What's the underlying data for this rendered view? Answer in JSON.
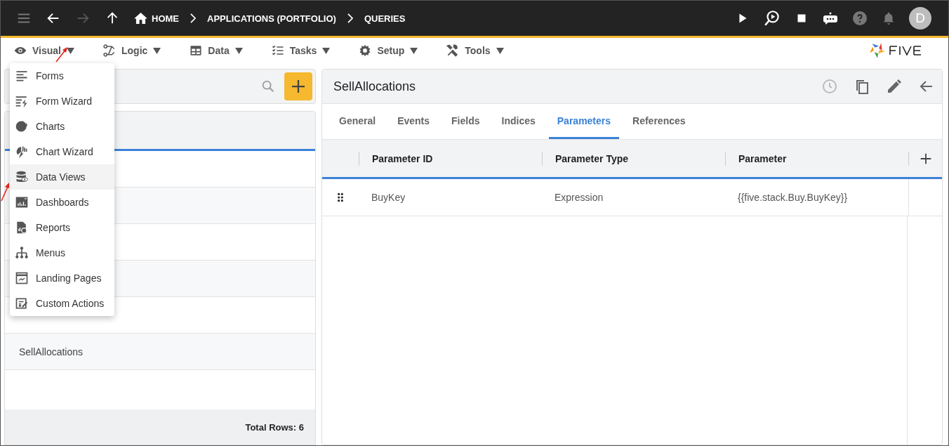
{
  "breadcrumbs": [
    {
      "label": "HOME",
      "kind": "home"
    },
    {
      "label": "APPLICATIONS (PORTFOLIO)",
      "kind": "crumb"
    },
    {
      "label": "QUERIES",
      "kind": "crumb"
    }
  ],
  "user": {
    "initial": "D"
  },
  "toolbar": [
    "Visual",
    "Logic",
    "Data",
    "Tasks",
    "Setup",
    "Tools"
  ],
  "menu": [
    {
      "label": "Forms",
      "highlighted": false
    },
    {
      "label": "Form Wizard",
      "highlighted": false
    },
    {
      "label": "Charts",
      "highlighted": false
    },
    {
      "label": "Chart Wizard",
      "highlighted": false
    },
    {
      "label": "Data Views",
      "highlighted": true
    },
    {
      "label": "Dashboards",
      "highlighted": false
    },
    {
      "label": "Reports",
      "highlighted": false
    },
    {
      "label": "Menus",
      "highlighted": false
    },
    {
      "label": "Landing Pages",
      "highlighted": false
    },
    {
      "label": "Custom Actions",
      "highlighted": false
    }
  ],
  "list": {
    "rows": [
      "SellAllocations"
    ],
    "total": "Total Rows: 6"
  },
  "detail": {
    "title": "SellAllocations",
    "tabs": [
      {
        "label": "General",
        "selected": false
      },
      {
        "label": "Events",
        "selected": false
      },
      {
        "label": "Fields",
        "selected": false
      },
      {
        "label": "Indices",
        "selected": false
      },
      {
        "label": "Parameters",
        "selected": true
      },
      {
        "label": "References",
        "selected": false
      }
    ],
    "table": {
      "columns": [
        "Parameter ID",
        "Parameter Type",
        "Parameter"
      ],
      "rows": [
        [
          "BuyKey",
          "Expression",
          "{{five.stack.Buy.BuyKey}}"
        ]
      ]
    }
  }
}
